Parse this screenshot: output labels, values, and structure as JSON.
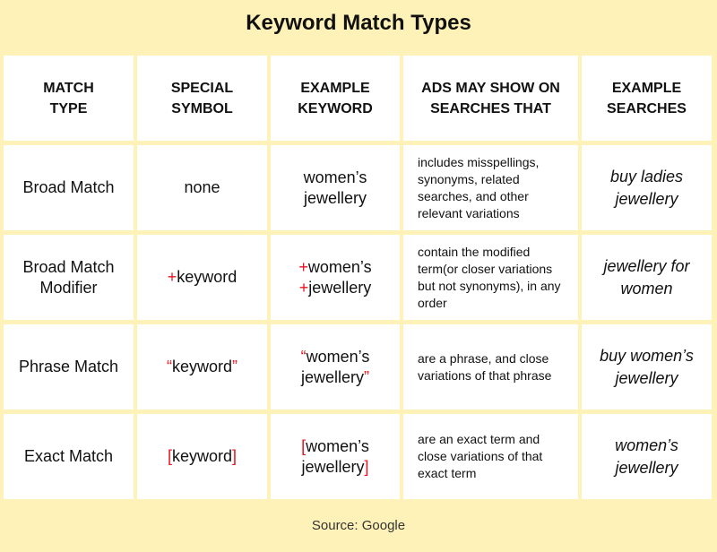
{
  "title": "Keyword Match Types",
  "accent_color": "#e8141e",
  "background_color": "#fff2b8",
  "headers": [
    "MATCH TYPE",
    "SPECIAL SYMBOL",
    "EXAMPLE KEYWORD",
    "ADS MAY SHOW ON SEARCHES THAT",
    "EXAMPLE SEARCHES"
  ],
  "headers_lines": [
    [
      "MATCH",
      "TYPE"
    ],
    [
      "SPECIAL",
      "SYMBOL"
    ],
    [
      "EXAMPLE",
      "KEYWORD"
    ],
    [
      "ADS MAY SHOW ON",
      "SEARCHES THAT"
    ],
    [
      "EXAMPLE",
      "SEARCHES"
    ]
  ],
  "rows": [
    {
      "match_type": "Broad Match",
      "symbol": {
        "pre": "",
        "text": "none",
        "post": ""
      },
      "keyword": {
        "l1_pre": "",
        "l1": "women’s",
        "l2_pre": "",
        "l2": "jewellery",
        "l2_post": ""
      },
      "description": "includes misspellings, synonyms, related searches, and other relevant variations",
      "example": "buy ladies jewellery"
    },
    {
      "match_type": "Broad Match Modifier",
      "symbol": {
        "pre": "+",
        "text": "keyword",
        "post": ""
      },
      "keyword": {
        "l1_pre": "+",
        "l1": "women’s",
        "l2_pre": "+",
        "l2": "jewellery",
        "l2_post": ""
      },
      "description": "contain the modified term(or closer variations but not synonyms), in any order",
      "example": "jewellery for women"
    },
    {
      "match_type": "Phrase Match",
      "symbol": {
        "pre": "“",
        "text": "keyword",
        "post": "”"
      },
      "keyword": {
        "l1_pre": "“",
        "l1": "women’s",
        "l2_pre": "",
        "l2": "jewellery",
        "l2_post": "”"
      },
      "description": "are a phrase, and close variations of that phrase",
      "example": "buy women’s jewellery"
    },
    {
      "match_type": "Exact Match",
      "symbol": {
        "pre": "[",
        "text": "keyword",
        "post": "]"
      },
      "keyword": {
        "l1_pre": "[",
        "l1": "women’s",
        "l2_pre": "",
        "l2": "jewellery",
        "l2_post": "]"
      },
      "description": "are an exact term and close variations of that exact term",
      "example": "women’s jewellery"
    }
  ],
  "source": "Source: Google"
}
